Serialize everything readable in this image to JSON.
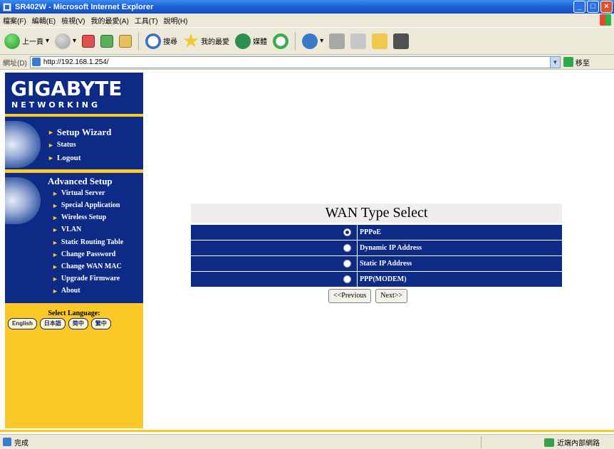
{
  "window": {
    "title": "SR402W - Microsoft Internet Explorer"
  },
  "menubar": {
    "items": [
      "檔案(F)",
      "編輯(E)",
      "檢視(V)",
      "我的最愛(A)",
      "工具(T)",
      "說明(H)"
    ]
  },
  "toolbar": {
    "back_label": "上一頁",
    "search_label": "搜尋",
    "favorites_label": "我的最愛",
    "media_label": "媒體"
  },
  "address": {
    "label": "網址(D)",
    "url": "http://192.168.1.254/",
    "go_label": "移至"
  },
  "sidebar": {
    "logo_main": "GIGABYTE",
    "logo_sub": "NETWORKING",
    "primary_links": [
      "Setup Wizard",
      "Status",
      "Logout"
    ],
    "advanced_title": "Advanced Setup",
    "advanced_links": [
      "Virtual Server",
      "Special Application",
      "Wireless Setup",
      "VLAN",
      "Static Routing Table",
      "Change Password",
      "Change WAN MAC",
      "Upgrade Firmware",
      "About"
    ],
    "language_label": "Select Language:",
    "languages": [
      "English",
      "日本語",
      "简中",
      "繁中"
    ]
  },
  "main": {
    "title": "WAN Type Select",
    "options": [
      {
        "label": "PPPoE",
        "selected": true
      },
      {
        "label": "Dynamic IP Address",
        "selected": false
      },
      {
        "label": "Static IP Address",
        "selected": false
      },
      {
        "label": "PPP(MODEM)",
        "selected": false
      }
    ],
    "previous_label": "<<Previous",
    "next_label": "Next>>"
  },
  "statusbar": {
    "status_text": "完成",
    "zone_text": "近端內部網路"
  },
  "colors": {
    "brand_blue": "#0c2a86",
    "brand_yellow": "#fbc925"
  }
}
